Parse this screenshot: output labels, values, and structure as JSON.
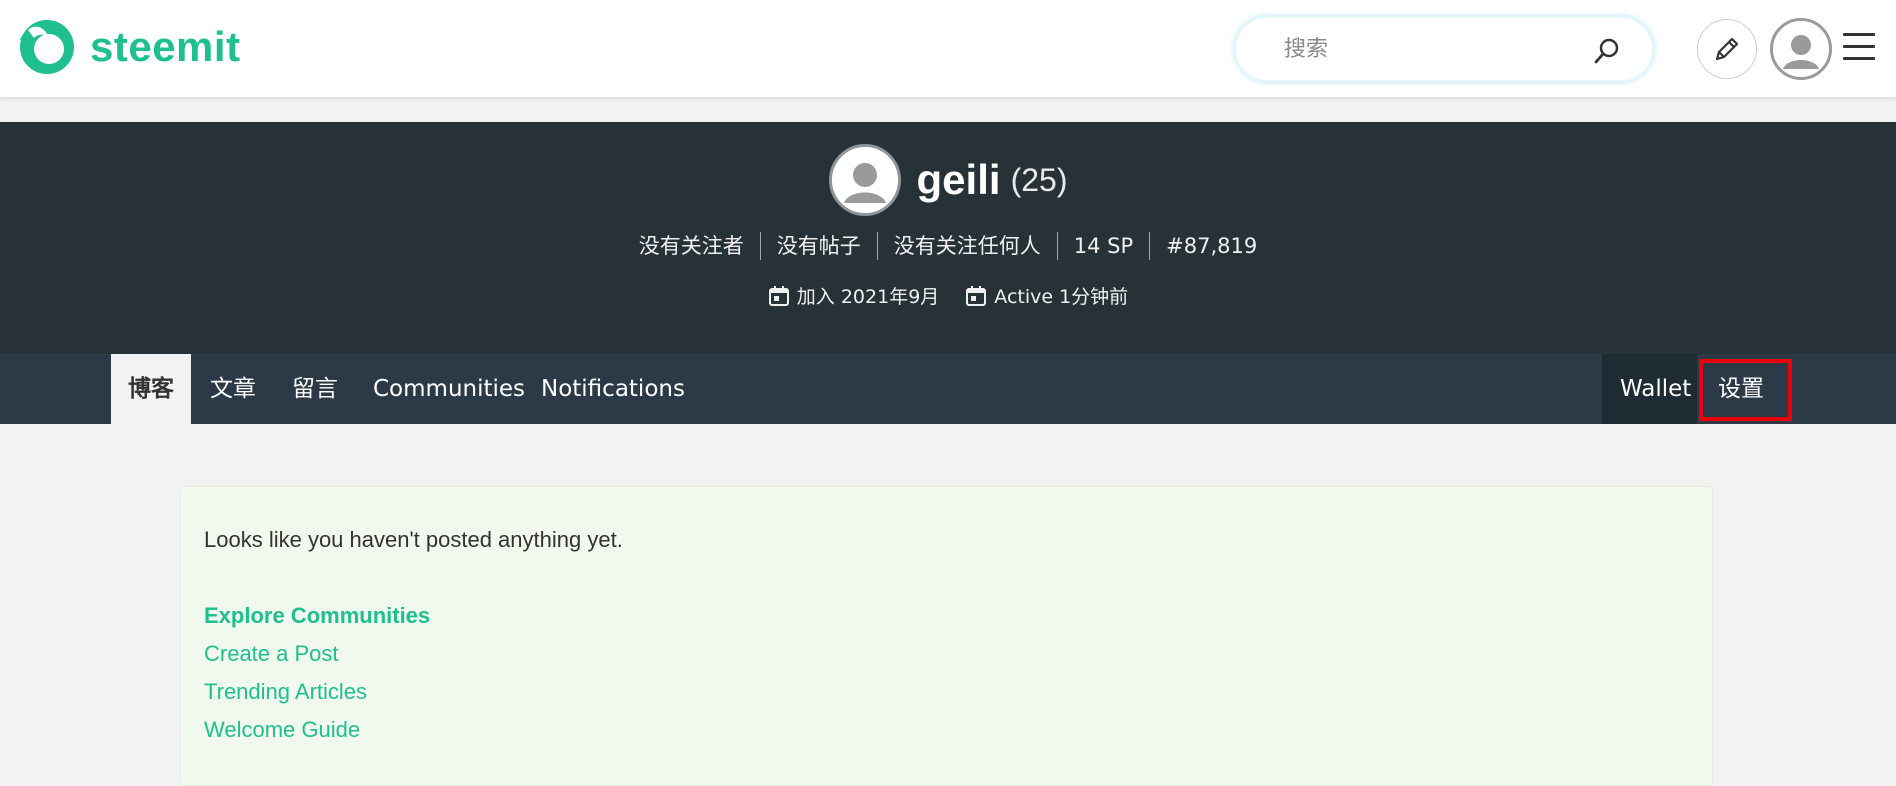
{
  "brand": {
    "name": "steemit",
    "color": "#1fbf8f"
  },
  "header": {
    "search_placeholder": "搜索",
    "icons": [
      "steemit-logo-icon",
      "search-icon",
      "pencil-icon",
      "user-avatar-icon",
      "hamburger-menu-icon"
    ]
  },
  "profile": {
    "username": "geili",
    "reputation": "(25)",
    "stats": [
      "没有关注者",
      "没有帖子",
      "没有关注任何人",
      "14 SP",
      "#87,819"
    ],
    "joined": "加入 2021年9月",
    "active": "Active 1分钟前"
  },
  "nav": {
    "tabs": [
      "博客",
      "文章",
      "留言",
      "Communities",
      "Notifications"
    ],
    "active_tab": "博客",
    "right_tabs": [
      "Wallet",
      "设置"
    ],
    "highlighted": "设置",
    "highlight_color": "#e8000b"
  },
  "content": {
    "empty_message": "Looks like you haven't posted anything yet.",
    "links": [
      "Explore Communities",
      "Create a Post",
      "Trending Articles",
      "Welcome Guide"
    ]
  }
}
